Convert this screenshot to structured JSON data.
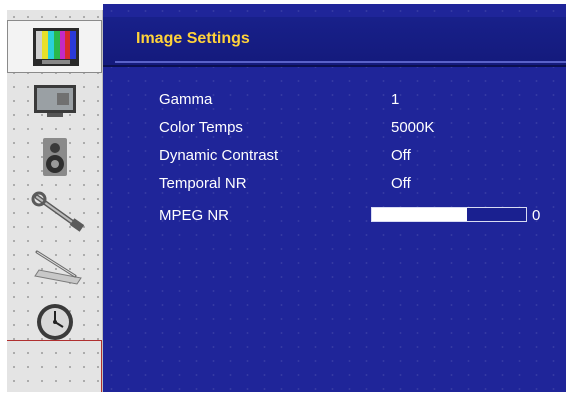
{
  "header": {
    "title": "Image Settings"
  },
  "menu": [
    {
      "label": "Gamma",
      "value": "1"
    },
    {
      "label": "Color Temps",
      "value": "5000K"
    },
    {
      "label": "Dynamic Contrast",
      "value": "Off"
    },
    {
      "label": "Temporal NR",
      "value": "Off"
    }
  ],
  "mpeg": {
    "label": "MPEG NR",
    "value": "0",
    "level_fraction": 0.62
  },
  "sidebar": [
    {
      "icon": "color-bars-icon"
    },
    {
      "icon": "monitor-icon"
    },
    {
      "icon": "speaker-icon"
    },
    {
      "icon": "wrench-icon"
    },
    {
      "icon": "pen-ruler-icon"
    },
    {
      "icon": "globe-clock-icon"
    }
  ],
  "colors": {
    "panel": "#1f2599",
    "title": "#ffd23a",
    "text": "#ffffff"
  }
}
